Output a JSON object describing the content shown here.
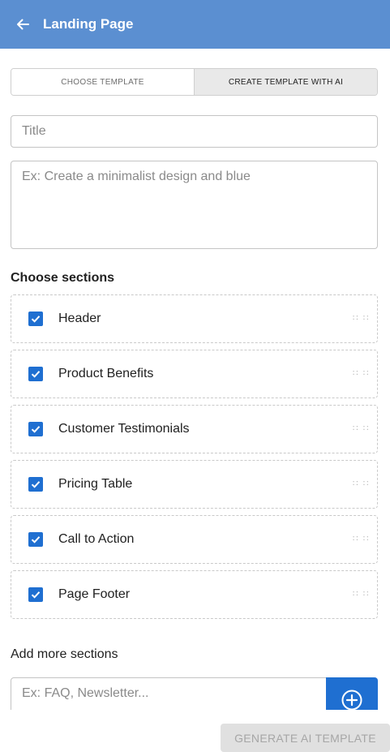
{
  "appbar": {
    "title": "Landing Page",
    "back_icon": "arrow-left-icon",
    "color": "#5b8fd1"
  },
  "tabs": [
    {
      "label": "CHOOSE TEMPLATE",
      "active": false
    },
    {
      "label": "CREATE TEMPLATE WITH AI",
      "active": true
    }
  ],
  "form": {
    "title_placeholder": "Title",
    "title_value": "",
    "prompt_placeholder": "Ex: Create a minimalist design and blue",
    "prompt_value": ""
  },
  "sections": {
    "heading": "Choose sections",
    "items": [
      {
        "label": "Header",
        "checked": true
      },
      {
        "label": "Product Benefits",
        "checked": true
      },
      {
        "label": "Customer Testimonials",
        "checked": true
      },
      {
        "label": "Pricing Table",
        "checked": true
      },
      {
        "label": "Call to Action",
        "checked": true
      },
      {
        "label": "Page Footer",
        "checked": true
      }
    ],
    "drag_handle_glyph": ":: ::",
    "checkbox_color": "#1f6fd1"
  },
  "add_more": {
    "heading": "Add more sections",
    "placeholder": "Ex: FAQ, Newsletter...",
    "value": "",
    "add_icon": "plus-circle-icon"
  },
  "footer": {
    "generate_label": "GENERATE AI TEMPLATE",
    "generate_disabled": true
  }
}
